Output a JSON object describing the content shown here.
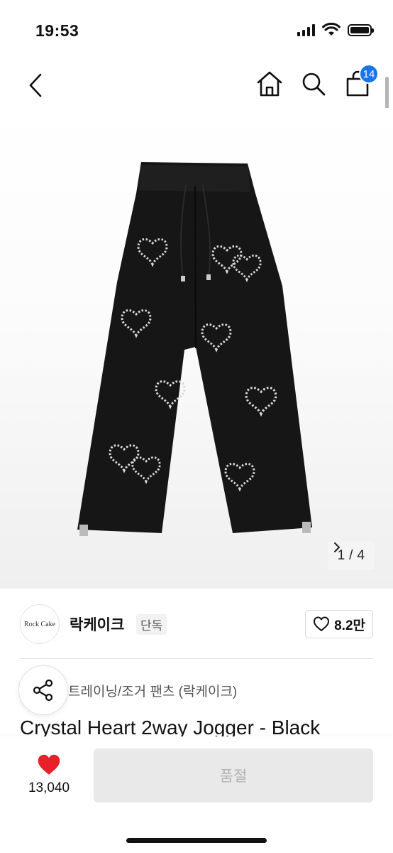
{
  "status_bar": {
    "time": "19:53"
  },
  "nav": {
    "cart_count": "14"
  },
  "gallery": {
    "page_current": "1",
    "page_separator": "/",
    "page_total": "4"
  },
  "brand": {
    "logo_text": "Rock Cake",
    "name": "락케이크",
    "tag": "단독",
    "like_count": "8.2만"
  },
  "product": {
    "category": "트레이닝/조거 팬츠 (락케이크)",
    "title": "Crystal Heart 2way Jogger - Black"
  },
  "bottom": {
    "wish_count": "13,040",
    "buy_label": "품절"
  },
  "colors": {
    "accent": "#1a73e8",
    "heart": "#e8202a",
    "disabled": "#e9e9e9"
  }
}
